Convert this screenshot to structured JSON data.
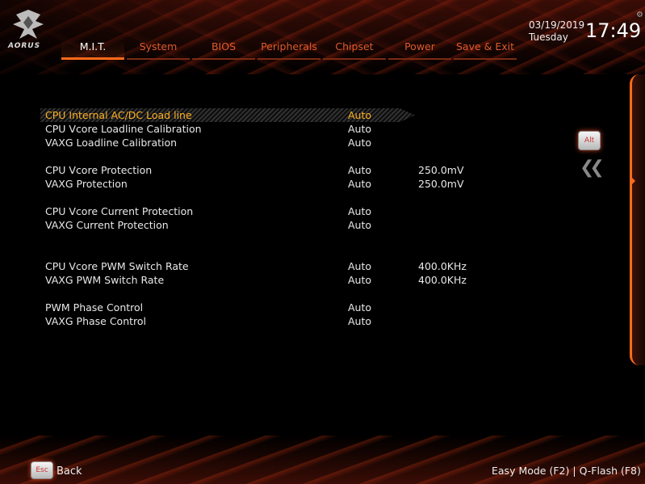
{
  "header": {
    "logo_text": "AORUS",
    "date": "03/19/2019",
    "day": "Tuesday",
    "time": "17:49"
  },
  "tabs": [
    {
      "label": "M.I.T.",
      "active": true
    },
    {
      "label": "System"
    },
    {
      "label": "BIOS"
    },
    {
      "label": "Peripherals"
    },
    {
      "label": "Chipset"
    },
    {
      "label": "Power"
    },
    {
      "label": "Save & Exit"
    }
  ],
  "settings": [
    {
      "label": "CPU Internal AC/DC Load line",
      "value": "Auto",
      "extra": ""
    },
    {
      "label": "CPU Vcore Loadline Calibration",
      "value": "Auto",
      "extra": ""
    },
    {
      "label": "VAXG Loadline Calibration",
      "value": "Auto",
      "extra": ""
    },
    {
      "label": "CPU Vcore Protection",
      "value": "Auto",
      "extra": "250.0mV"
    },
    {
      "label": "VAXG Protection",
      "value": "Auto",
      "extra": "250.0mV"
    },
    {
      "label": "CPU Vcore Current Protection",
      "value": "Auto",
      "extra": ""
    },
    {
      "label": "VAXG Current Protection",
      "value": "Auto",
      "extra": ""
    },
    {
      "label": "CPU Vcore PWM Switch Rate",
      "value": "Auto",
      "extra": "400.0KHz"
    },
    {
      "label": "VAXG PWM Switch Rate",
      "value": "Auto",
      "extra": "400.0KHz"
    },
    {
      "label": "PWM Phase Control",
      "value": "Auto",
      "extra": ""
    },
    {
      "label": "VAXG Phase Control",
      "value": "Auto",
      "extra": ""
    }
  ],
  "side": {
    "alt_label": "Alt",
    "chevron_icon": "double-chevron-left-icon"
  },
  "footer": {
    "esc_label": "Esc",
    "back_label": "Back",
    "easy_mode": "Easy Mode (F2)",
    "separator": "|",
    "qflash": "Q-Flash (F8)"
  },
  "colors": {
    "accent": "#ff6a1a",
    "selected_text": "#ffb020",
    "tab_text": "#e05a2a"
  }
}
